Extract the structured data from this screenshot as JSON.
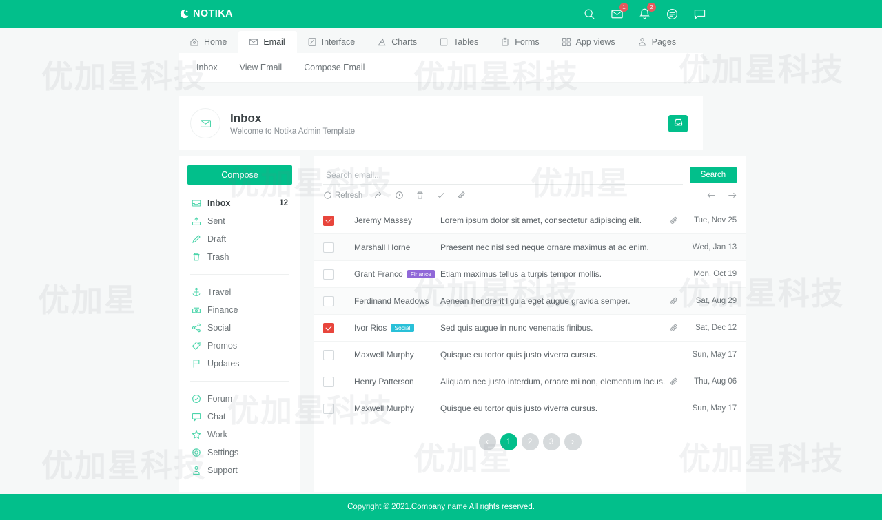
{
  "colors": {
    "brand_green": "#02bf8b",
    "badge_red": "#f9515b",
    "checkbox_red": "#e8453c",
    "tag_purple": "#9068d8",
    "tag_cyan": "#29c0d8",
    "page_bg": "#f6f8f8"
  },
  "topbar": {
    "brand": "NOTIKA",
    "icons": [
      {
        "name": "search-icon",
        "badge": null
      },
      {
        "name": "envelope-icon",
        "badge": "1"
      },
      {
        "name": "bell-icon",
        "badge": "2"
      },
      {
        "name": "list-icon",
        "badge": null
      },
      {
        "name": "comment-icon",
        "badge": null
      }
    ]
  },
  "nav": {
    "tabs": [
      {
        "label": "Home",
        "icon": "home-icon",
        "active": false
      },
      {
        "label": "Email",
        "icon": "envelope-icon",
        "active": true
      },
      {
        "label": "Interface",
        "icon": "window-icon",
        "active": false
      },
      {
        "label": "Charts",
        "icon": "chart-icon",
        "active": false
      },
      {
        "label": "Tables",
        "icon": "table-icon",
        "active": false
      },
      {
        "label": "Forms",
        "icon": "form-icon",
        "active": false
      },
      {
        "label": "App views",
        "icon": "grid-icon",
        "active": false
      },
      {
        "label": "Pages",
        "icon": "pages-icon",
        "active": false
      }
    ],
    "subnav": [
      "Inbox",
      "View Email",
      "Compose Email"
    ]
  },
  "page_header": {
    "icon": "envelope-icon",
    "title": "Inbox",
    "subtitle": "Welcome to Notika Admin Template",
    "action_icon": "inbox-download-icon"
  },
  "sidebar": {
    "compose_label": "Compose",
    "group1": [
      {
        "label": "Inbox",
        "icon": "inbox-icon",
        "count": "12",
        "active": true
      },
      {
        "label": "Sent",
        "icon": "sent-icon",
        "count": null,
        "active": false
      },
      {
        "label": "Draft",
        "icon": "pencil-icon",
        "count": null,
        "active": false
      },
      {
        "label": "Trash",
        "icon": "trash-icon",
        "count": null,
        "active": false
      }
    ],
    "group2": [
      {
        "label": "Travel",
        "icon": "anchor-icon"
      },
      {
        "label": "Finance",
        "icon": "finance-icon"
      },
      {
        "label": "Social",
        "icon": "share-icon"
      },
      {
        "label": "Promos",
        "icon": "tag-icon"
      },
      {
        "label": "Updates",
        "icon": "flag-icon"
      }
    ],
    "group3": [
      {
        "label": "Forum",
        "icon": "check-circle-icon"
      },
      {
        "label": "Chat",
        "icon": "chat-icon"
      },
      {
        "label": "Work",
        "icon": "star-icon"
      },
      {
        "label": "Settings",
        "icon": "gear-icon"
      },
      {
        "label": "Support",
        "icon": "support-icon"
      }
    ]
  },
  "search": {
    "placeholder": "Search email...",
    "value": "",
    "button_label": "Search"
  },
  "toolbar": {
    "refresh_label": "Refresh",
    "tools": [
      {
        "name": "refresh-icon"
      },
      {
        "name": "forward-icon"
      },
      {
        "name": "clock-icon"
      },
      {
        "name": "trash-icon"
      },
      {
        "name": "check-icon"
      },
      {
        "name": "link-icon"
      }
    ],
    "nav": [
      {
        "name": "arrow-left-icon"
      },
      {
        "name": "arrow-right-icon"
      }
    ]
  },
  "emails": [
    {
      "checked": true,
      "sender": "Jeremy Massey",
      "tag": null,
      "subject": "Lorem ipsum dolor sit amet, consectetur adipiscing elit.",
      "attachment": true,
      "date": "Tue, Nov 25",
      "alt": false
    },
    {
      "checked": false,
      "sender": "Marshall Horne",
      "tag": null,
      "subject": "Praesent nec nisl sed neque ornare maximus at ac enim.",
      "attachment": false,
      "date": "Wed, Jan 13",
      "alt": true
    },
    {
      "checked": false,
      "sender": "Grant Franco",
      "tag": {
        "label": "Finance",
        "color": "#9068d8"
      },
      "subject": "Etiam maximus tellus a turpis tempor mollis.",
      "attachment": false,
      "date": "Mon, Oct 19",
      "alt": false
    },
    {
      "checked": false,
      "sender": "Ferdinand Meadows",
      "tag": null,
      "subject": "Aenean hendrerit ligula eget augue gravida semper.",
      "attachment": true,
      "date": "Sat, Aug 29",
      "alt": true
    },
    {
      "checked": true,
      "sender": "Ivor Rios",
      "tag": {
        "label": "Social",
        "color": "#29c0d8"
      },
      "subject": "Sed quis augue in nunc venenatis finibus.",
      "attachment": true,
      "date": "Sat, Dec 12",
      "alt": false
    },
    {
      "checked": false,
      "sender": "Maxwell Murphy",
      "tag": null,
      "subject": "Quisque eu tortor quis justo viverra cursus.",
      "attachment": false,
      "date": "Sun, May 17",
      "alt": false
    },
    {
      "checked": false,
      "sender": "Henry Patterson",
      "tag": null,
      "subject": "Aliquam nec justo interdum, ornare mi non, elementum lacus.",
      "attachment": true,
      "date": "Thu, Aug 06",
      "alt": false
    },
    {
      "checked": false,
      "sender": "Maxwell Murphy",
      "tag": null,
      "subject": "Quisque eu tortor quis justo viverra cursus.",
      "attachment": false,
      "date": "Sun, May 17",
      "alt": false
    }
  ],
  "pagination": {
    "items": [
      {
        "label": "‹",
        "active": false,
        "name": "page-prev"
      },
      {
        "label": "1",
        "active": true,
        "name": "page-1"
      },
      {
        "label": "2",
        "active": false,
        "name": "page-2"
      },
      {
        "label": "3",
        "active": false,
        "name": "page-3"
      },
      {
        "label": "›",
        "active": false,
        "name": "page-next"
      }
    ]
  },
  "footer": {
    "text": "Copyright © 2021.Company name All rights reserved."
  },
  "watermarks": [
    "优加星科技",
    "优加星科技",
    "优加星科技",
    "优加星",
    "优加星科技",
    "优加星科技",
    "优加星科技",
    "优加星"
  ]
}
